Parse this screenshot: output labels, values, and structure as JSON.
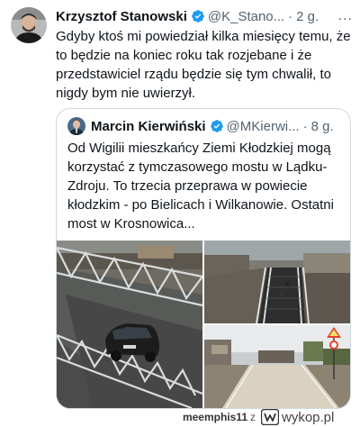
{
  "tweet": {
    "author_name": "Krzysztof Stanowski",
    "author_handle": "@K_Stano...",
    "separator": "·",
    "time": "2 g.",
    "more": "...",
    "text": "Gdyby ktoś mi powiedział kilka miesięcy temu, że to będzie na koniec roku tak rozjebane i że przedstawiciel rządu będzie się tym chwalił, to nigdy bym nie uwierzył.",
    "verified_icon": "verified-badge-icon"
  },
  "quoted": {
    "author_name": "Marcin Kierwiński",
    "author_handle": "@MKierwi...",
    "separator": "·",
    "time": "8 g.",
    "text": "Od Wigilii mieszkańcy Ziemi Kłodzkiej mogą korzystać z tymczasowego mostu w Lądku-Zdroju. To trzecia przeprawa w powiecie kłodzkim - po Bielicach i Wilkanowie. Ostatni most w Krosnowica..."
  },
  "footer": {
    "username": "meemphis11",
    "conj": "z",
    "brand": "wykop.pl"
  },
  "colors": {
    "verified": "#1d9bf0",
    "secondary_text": "#536471",
    "border": "#cfd9de"
  }
}
